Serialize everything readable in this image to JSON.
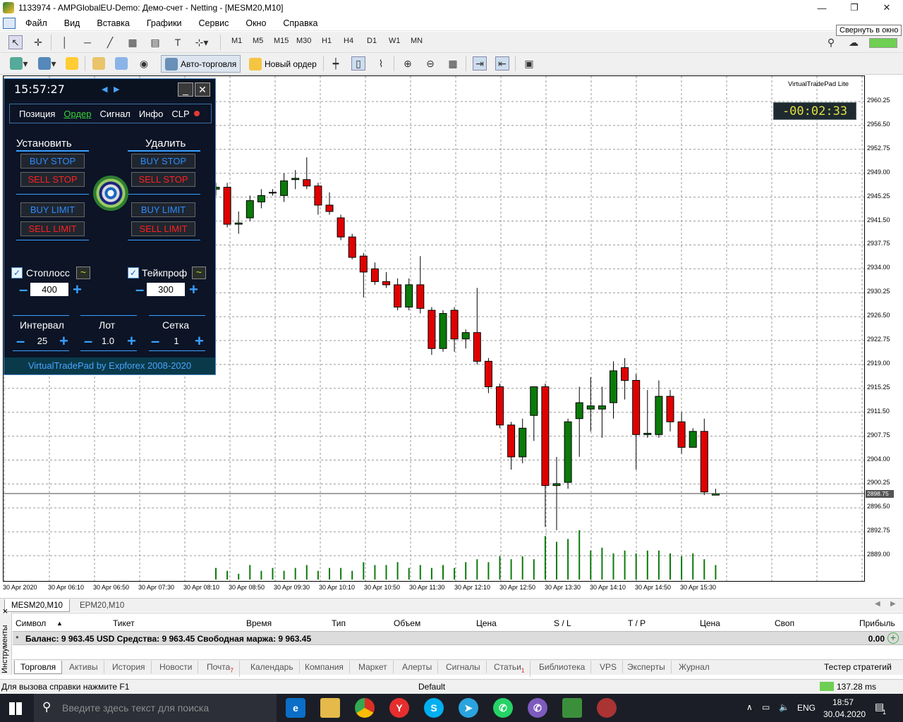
{
  "window": {
    "title": "1133974 - AMPGlobalEU-Demo: Демо-счет - Netting - [MESM20,M10]",
    "minimize": "—",
    "restore": "❐",
    "close": "✕",
    "tooltip": "Свернуть в окно"
  },
  "menu": [
    "Файл",
    "Вид",
    "Вставка",
    "Графики",
    "Сервис",
    "Окно",
    "Справка"
  ],
  "timeframes": [
    "M1",
    "M5",
    "M15",
    "M30",
    "H1",
    "H4",
    "D1",
    "W1",
    "MN"
  ],
  "toolbar2": {
    "auto_trading": "Авто-торговля",
    "new_order": "Новый ордер"
  },
  "chart": {
    "symbol": "MESM20,M10",
    "indicator_label": "VirtualTradePad Lite",
    "countdown": "-00:02:33",
    "current_price": "2898.75",
    "price_labels": [
      "2960.25",
      "2956.50",
      "2952.75",
      "2949.00",
      "2945.25",
      "2941.50",
      "2937.75",
      "2934.00",
      "2930.25",
      "2926.50",
      "2922.75",
      "2919.00",
      "2915.25",
      "2911.50",
      "2907.75",
      "2904.00",
      "2900.25",
      "2896.50",
      "2892.75",
      "2889.00"
    ],
    "time_labels": [
      "30 Apr 2020",
      "30 Apr 06:10",
      "30 Apr 06:50",
      "30 Apr 07:30",
      "30 Apr 08:10",
      "30 Apr 08:50",
      "30 Apr 09:30",
      "30 Apr 10:10",
      "30 Apr 10:50",
      "30 Apr 11:30",
      "30 Apr 12:10",
      "30 Apr 12:50",
      "30 Apr 13:30",
      "30 Apr 14:10",
      "30 Apr 14:50",
      "30 Apr 15:30"
    ]
  },
  "chart_data": {
    "type": "candlestick",
    "ylim": [
      2887.5,
      2962.0
    ],
    "candles": [
      [
        2946.5,
        2947.5,
        2945.5,
        2946.8
      ],
      [
        2946.8,
        2947.5,
        2940.5,
        2941.0
      ],
      [
        2941.0,
        2943.0,
        2939.5,
        2941.2
      ],
      [
        2942.0,
        2945.5,
        2941.5,
        2944.7
      ],
      [
        2944.5,
        2946.5,
        2943.5,
        2945.5
      ],
      [
        2946.0,
        2946.5,
        2945.5,
        2946.0
      ],
      [
        2945.5,
        2949.0,
        2944.5,
        2947.8
      ],
      [
        2948.0,
        2949.5,
        2946.5,
        2948.2
      ],
      [
        2948.0,
        2951.5,
        2946.5,
        2947.0
      ],
      [
        2947.0,
        2947.5,
        2942.5,
        2944.0
      ],
      [
        2944.0,
        2946.0,
        2942.5,
        2943.0
      ],
      [
        2942.0,
        2942.5,
        2938.5,
        2939.0
      ],
      [
        2939.0,
        2939.5,
        2935.5,
        2935.8
      ],
      [
        2936.0,
        2936.5,
        2929.5,
        2933.5
      ],
      [
        2934.0,
        2935.0,
        2931.5,
        2932.0
      ],
      [
        2932.0,
        2933.5,
        2931.0,
        2931.5
      ],
      [
        2931.5,
        2932.5,
        2927.5,
        2928.0
      ],
      [
        2928.0,
        2932.5,
        2927.5,
        2931.5
      ],
      [
        2931.5,
        2936.0,
        2927.0,
        2927.8
      ],
      [
        2927.5,
        2928.0,
        2920.5,
        2921.5
      ],
      [
        2921.5,
        2927.5,
        2921.0,
        2927.0
      ],
      [
        2927.5,
        2928.0,
        2921.0,
        2923.0
      ],
      [
        2923.0,
        2924.5,
        2921.5,
        2924.0
      ],
      [
        2924.0,
        2931.0,
        2919.0,
        2919.5
      ],
      [
        2919.5,
        2920.0,
        2914.5,
        2915.5
      ],
      [
        2915.5,
        2916.0,
        2909.0,
        2909.5
      ],
      [
        2909.5,
        2910.0,
        2902.5,
        2904.5
      ],
      [
        2904.5,
        2910.5,
        2903.5,
        2909.0
      ],
      [
        2911.0,
        2915.5,
        2907.0,
        2915.5
      ],
      [
        2915.5,
        2916.0,
        2893.5,
        2900.0
      ],
      [
        2900.0,
        2904.5,
        2893.0,
        2900.3
      ],
      [
        2900.5,
        2910.5,
        2899.5,
        2910.0
      ],
      [
        2910.5,
        2915.5,
        2904.5,
        2913.0
      ],
      [
        2912.0,
        2917.0,
        2908.5,
        2912.5
      ],
      [
        2912.0,
        2915.5,
        2907.5,
        2912.5
      ],
      [
        2913.0,
        2919.5,
        2910.5,
        2918.0
      ],
      [
        2918.5,
        2920.0,
        2913.5,
        2916.5
      ],
      [
        2916.5,
        2917.5,
        2902.5,
        2908.0
      ],
      [
        2908.0,
        2915.0,
        2907.5,
        2908.2
      ],
      [
        2908.0,
        2916.5,
        2907.5,
        2914.0
      ],
      [
        2914.0,
        2915.0,
        2908.5,
        2910.0
      ],
      [
        2910.0,
        2911.5,
        2905.0,
        2906.0
      ],
      [
        2906.0,
        2909.0,
        2906.0,
        2908.5
      ],
      [
        2908.5,
        2910.5,
        2898.5,
        2899.0
      ],
      [
        2898.5,
        2899.5,
        2898.5,
        2898.75
      ]
    ],
    "volumes": [
      4,
      3,
      2,
      5,
      3,
      4,
      3,
      4,
      5,
      3,
      4,
      4,
      3,
      6,
      5,
      5,
      6,
      4,
      5,
      4,
      5,
      4,
      6,
      7,
      6,
      8,
      7,
      8,
      7,
      15,
      13,
      14,
      17,
      10,
      11,
      9,
      10,
      9,
      10,
      10,
      9,
      8,
      9,
      7,
      5
    ]
  },
  "vtp": {
    "time": "15:57:27",
    "tabs": [
      "Позиция",
      "Ордер",
      "Сигнал",
      "Инфо",
      "CLP"
    ],
    "install": "Установить",
    "delete": "Удалить",
    "buy_stop": "BUY STOP",
    "sell_stop": "SELL STOP",
    "buy_limit": "BUY LIMIT",
    "sell_limit": "SELL LIMIT",
    "stoploss_label": "Стоплосс",
    "stoploss_value": "400",
    "takeprofit_label": "Тейкпроф",
    "takeprofit_value": "300",
    "interval_label": "Интервал",
    "interval_value": "25",
    "lot_label": "Лот",
    "lot_value": "1.0",
    "grid_label": "Сетка",
    "grid_value": "1",
    "footer": "VirtualTradePad by Expforex 2008-2020"
  },
  "chart_tabs": [
    "MESM20,M10",
    "EPM20,M10"
  ],
  "terminal": {
    "side_label": "Инструменты",
    "headers": [
      "Символ",
      "Тикет",
      "Время",
      "Тип",
      "Объем",
      "Цена",
      "S / L",
      "T / P",
      "Цена",
      "Своп",
      "Прибыль"
    ],
    "balance_text": "Баланс: 9 963.45 USD  Средства: 9 963.45  Свободная маржа: 9 963.45",
    "profit": "0.00",
    "tabs": [
      "Торговля",
      "Активы",
      "История",
      "Новости",
      "Почта",
      "Календарь",
      "Компания",
      "Маркет",
      "Алерты",
      "Сигналы",
      "Статьи",
      "Библиотека",
      "VPS",
      "Эксперты",
      "Журнал"
    ],
    "mail_badge": "7",
    "articles_badge": "1",
    "tester": "Тестер стратегий"
  },
  "status": {
    "help": "Для вызова справки нажмите F1",
    "profile": "Default",
    "ping": "137.28 ms"
  },
  "taskbar": {
    "search_placeholder": "Введите здесь текст для поиска",
    "time": "18:57",
    "date": "30.04.2020",
    "lang": "ENG",
    "notif_count": "1"
  }
}
